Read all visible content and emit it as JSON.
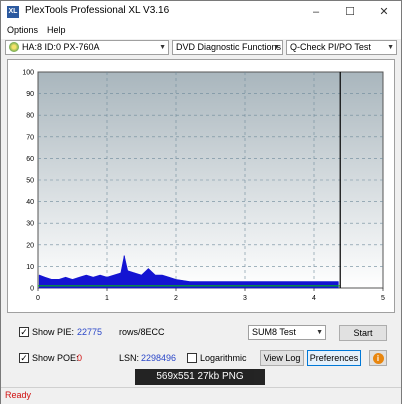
{
  "window": {
    "title": "PlexTools Professional XL V3.16",
    "app_icon": "XL",
    "minimize": "–",
    "maximize": "☐",
    "close": "✕"
  },
  "menu": {
    "options": "Options",
    "help": "Help"
  },
  "toolbar": {
    "drive": "HA:8 ID:0  PX-760A",
    "function": "DVD Diagnostic Functions",
    "test": "Q-Check PI/PO Test"
  },
  "chart_data": {
    "type": "area",
    "y_ticks": [
      "100",
      "90",
      "80",
      "70",
      "60",
      "50",
      "40",
      "30",
      "20",
      "10",
      "0"
    ],
    "x_ticks": [
      "0",
      "1",
      "2",
      "3",
      "4",
      "5"
    ],
    "ylim": [
      0,
      100
    ],
    "xlim": [
      0,
      5
    ],
    "end_marker_x": 4.38,
    "grid": true,
    "colors": {
      "pie": "#1414d2",
      "sum8": "#00c800",
      "marker": "#000000",
      "bg_top": "#a9b6bd",
      "bg_bottom": "#ffffff"
    },
    "series": [
      {
        "x": [
          0.02,
          0.1,
          0.2,
          0.3,
          0.4,
          0.5,
          0.6,
          0.7,
          0.8,
          0.9,
          1.0,
          1.1,
          1.2,
          1.25,
          1.3,
          1.4,
          1.5,
          1.6,
          1.7,
          1.8,
          1.9,
          2.0,
          2.2,
          2.4,
          2.6,
          2.8,
          3.0,
          3.2,
          3.4,
          3.6,
          3.8,
          4.0,
          4.2,
          4.35
        ],
        "values": [
          6,
          5,
          4,
          4,
          5,
          4,
          5,
          6,
          5,
          6,
          5,
          6,
          7,
          15,
          8,
          7,
          6,
          9,
          6,
          6,
          5,
          4,
          3,
          3,
          3,
          3,
          3,
          3,
          3,
          3,
          3,
          3,
          3,
          3
        ]
      }
    ]
  },
  "controls": {
    "show_pie_label": "Show PIE:",
    "show_pie_value": "22775",
    "pie_unit": "rows/8ECC",
    "show_poe_label": "Show POE:",
    "show_poe_value": "0",
    "lsn_label": "LSN:",
    "lsn_value": "2298496",
    "log_label": "Logarithmic",
    "test_select": "SUM8 Test",
    "start": "Start",
    "view_log": "View Log",
    "preferences": "Preferences",
    "info": "i",
    "check": "✓"
  },
  "status": {
    "text": "Ready"
  },
  "caption": {
    "text": "569x551 27kb PNG"
  }
}
